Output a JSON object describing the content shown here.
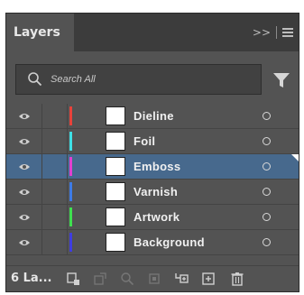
{
  "panel": {
    "tab_label": "Layers",
    "overflow_label": ">>"
  },
  "search": {
    "placeholder": "Search All"
  },
  "layers": [
    {
      "name": "Dieline",
      "color": "#e8423a",
      "selected": false
    },
    {
      "name": "Foil",
      "color": "#3ee0e6",
      "selected": false
    },
    {
      "name": "Emboss",
      "color": "#e23fd0",
      "selected": true
    },
    {
      "name": "Varnish",
      "color": "#3d7be6",
      "selected": false
    },
    {
      "name": "Artwork",
      "color": "#3fe04f",
      "selected": false
    },
    {
      "name": "Background",
      "color": "#3f3de0",
      "selected": false
    }
  ],
  "footer": {
    "count_label": "6 La..."
  },
  "icons": {
    "tab_overflow": "chevron-double-right-icon",
    "panel_menu": "hamburger-menu-icon",
    "search": "search-icon",
    "filter": "filter-funnel-icon",
    "visibility": "eye-icon",
    "target": "target-circle-icon",
    "footer": [
      "collect-for-export-icon",
      "make-clipping-mask-icon",
      "locate-object-icon",
      "create-sublayer-icon",
      "create-new-layer-icon",
      "delete-icon"
    ]
  },
  "colors": {
    "panel_bg": "#535353",
    "selected_row": "#47698d"
  }
}
